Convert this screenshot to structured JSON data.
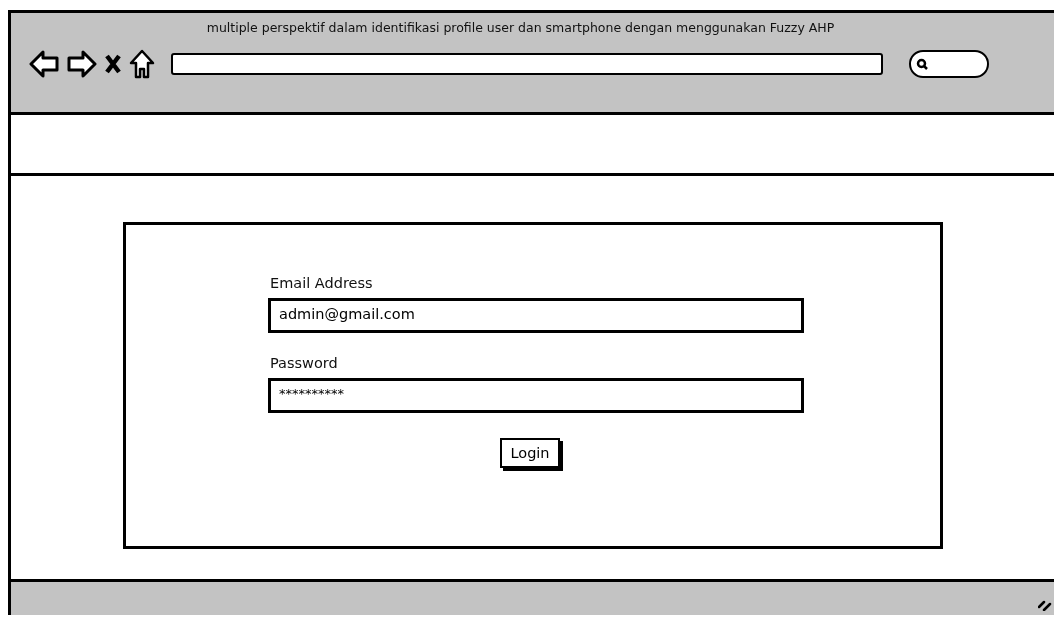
{
  "window": {
    "title": "multiple perspektif dalam identifikasi profile user dan smartphone dengan menggunakan Fuzzy AHP"
  },
  "login_form": {
    "email": {
      "label": "Email Address",
      "value": "admin@gmail.com"
    },
    "password": {
      "label": "Password",
      "value": "**********"
    },
    "button": "Login"
  }
}
